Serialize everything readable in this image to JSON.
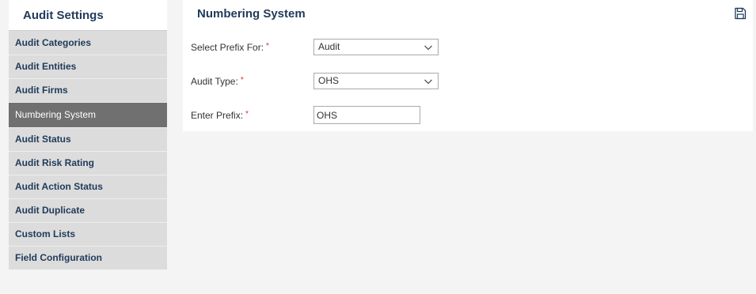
{
  "sidebar": {
    "title": "Audit Settings",
    "items": [
      {
        "label": "Audit Categories"
      },
      {
        "label": "Audit Entities"
      },
      {
        "label": "Audit Firms"
      },
      {
        "label": "Numbering System"
      },
      {
        "label": "Audit Status"
      },
      {
        "label": "Audit Risk Rating"
      },
      {
        "label": "Audit Action Status"
      },
      {
        "label": "Audit Duplicate"
      },
      {
        "label": "Custom Lists"
      },
      {
        "label": "Field Configuration"
      }
    ],
    "active_index": 3
  },
  "panel": {
    "title": "Numbering System",
    "save_icon": "save-icon"
  },
  "form": {
    "required_mark": "*",
    "prefix_for": {
      "label": "Select Prefix For:",
      "value": "Audit"
    },
    "audit_type": {
      "label": "Audit Type:",
      "value": "OHS"
    },
    "prefix": {
      "label": "Enter Prefix:",
      "value": "OHS"
    }
  },
  "colors": {
    "heading": "#1f3a5a",
    "active_item_bg": "#707070",
    "required": "#d32f2f"
  }
}
